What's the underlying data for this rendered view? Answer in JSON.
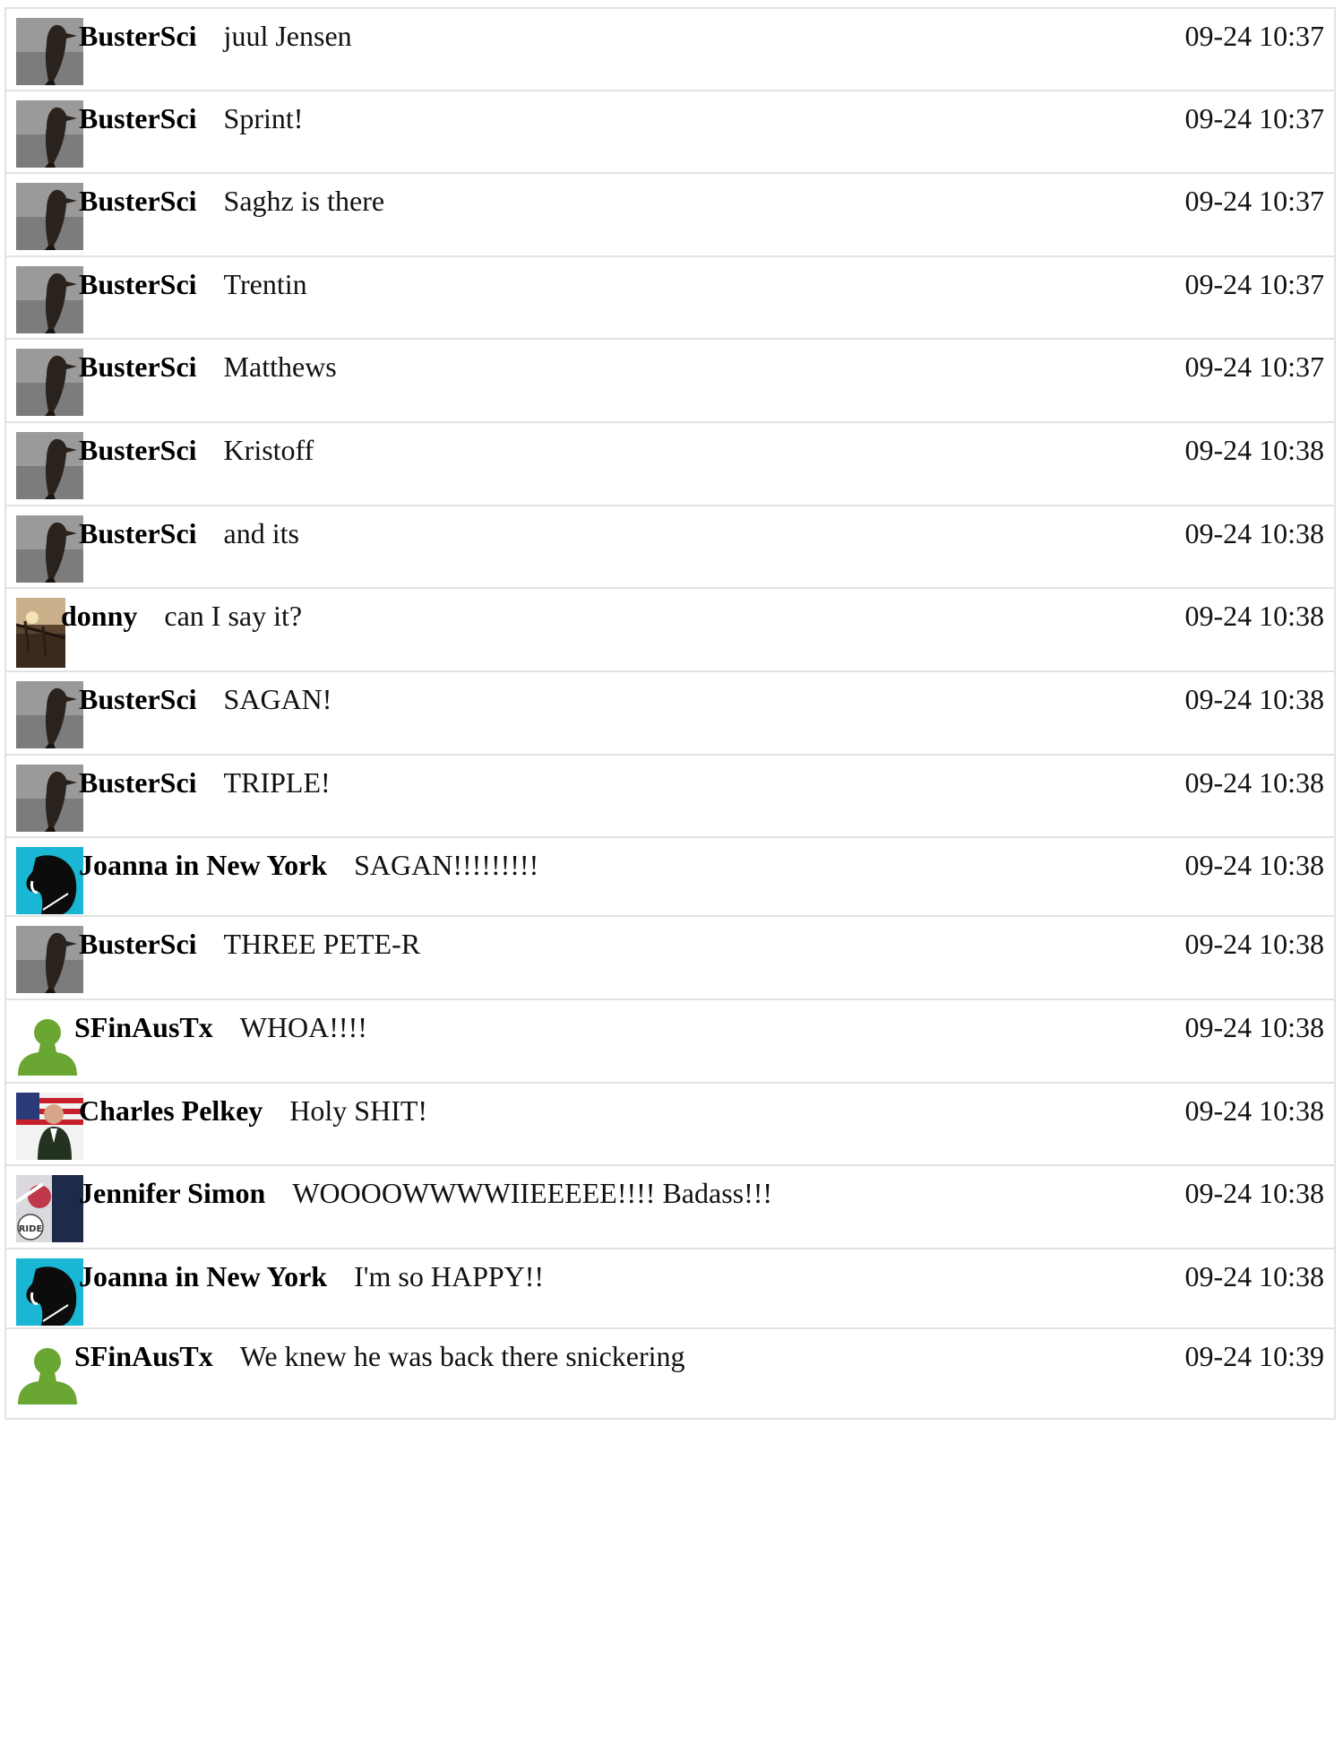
{
  "comments": [
    {
      "author": "BusterSci",
      "text": "juul Jensen",
      "time": "09-24 10:37",
      "avatar": "penguin-avatar"
    },
    {
      "author": "BusterSci",
      "text": "Sprint!",
      "time": "09-24 10:37",
      "avatar": "penguin-avatar"
    },
    {
      "author": "BusterSci",
      "text": "Saghz is there",
      "time": "09-24 10:37",
      "avatar": "penguin-avatar"
    },
    {
      "author": "BusterSci",
      "text": "Trentin",
      "time": "09-24 10:37",
      "avatar": "penguin-avatar"
    },
    {
      "author": "BusterSci",
      "text": "Matthews",
      "time": "09-24 10:37",
      "avatar": "penguin-avatar"
    },
    {
      "author": "BusterSci",
      "text": "Kristoff",
      "time": "09-24 10:38",
      "avatar": "penguin-avatar"
    },
    {
      "author": "BusterSci",
      "text": "and its",
      "time": "09-24 10:38",
      "avatar": "penguin-avatar"
    },
    {
      "author": "donny",
      "text": "can I say it?",
      "time": "09-24 10:38",
      "avatar": "landscape-avatar"
    },
    {
      "author": "BusterSci",
      "text": "SAGAN!",
      "time": "09-24 10:38",
      "avatar": "penguin-avatar"
    },
    {
      "author": "BusterSci",
      "text": "TRIPLE!",
      "time": "09-24 10:38",
      "avatar": "penguin-avatar"
    },
    {
      "author": "Joanna in New York",
      "text": "SAGAN!!!!!!!!!",
      "time": "09-24 10:38",
      "avatar": "horse-avatar"
    },
    {
      "author": "BusterSci",
      "text": "THREE PETE-R",
      "time": "09-24 10:38",
      "avatar": "penguin-avatar"
    },
    {
      "author": "SFinAusTx",
      "text": "WHOA!!!!",
      "time": "09-24 10:38",
      "avatar": "default-user-avatar"
    },
    {
      "author": "Charles Pelkey",
      "text": "Holy SHIT!",
      "time": "09-24 10:38",
      "avatar": "flag-portrait-avatar"
    },
    {
      "author": "Jennifer Simon",
      "text": "WOOOOWWWWIIEEEEE!!!! Badass!!!",
      "time": "09-24 10:38",
      "avatar": "ride-avatar"
    },
    {
      "author": "Joanna in New York",
      "text": "I'm so HAPPY!!",
      "time": "09-24 10:38",
      "avatar": "horse-avatar"
    },
    {
      "author": "SFinAusTx",
      "text": "We knew he was back there snickering",
      "time": "09-24 10:39",
      "avatar": "default-user-avatar"
    }
  ]
}
